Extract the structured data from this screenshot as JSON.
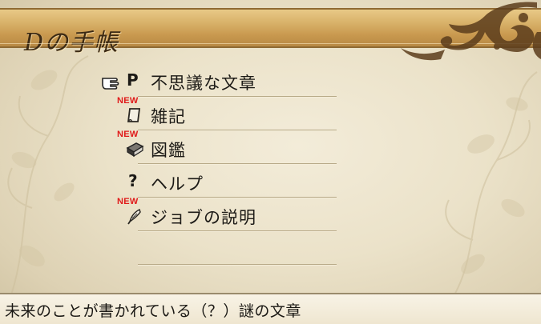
{
  "header": {
    "title": "Dの手帳"
  },
  "menu": {
    "items": [
      {
        "label": "不思議な文章",
        "icon": "pointing-hand-icon",
        "icon_glyph": "P",
        "is_new": false,
        "selected": true
      },
      {
        "label": "雑記",
        "icon": "note-page-icon",
        "is_new": true,
        "new_label": "NEW"
      },
      {
        "label": "図鑑",
        "icon": "book-icon",
        "is_new": true,
        "new_label": "NEW"
      },
      {
        "label": "ヘルプ",
        "icon": "question-icon",
        "icon_glyph": "?",
        "is_new": false
      },
      {
        "label": "ジョブの説明",
        "icon": "quill-icon",
        "is_new": true,
        "new_label": "NEW"
      },
      {
        "label": "",
        "icon": "",
        "is_new": false
      }
    ]
  },
  "description": {
    "text": "未来のことが書かれている（？）謎の文章"
  },
  "colors": {
    "header_gold": "#d9b26a",
    "parchment": "#ebe2c9",
    "new_badge": "#e01a1a",
    "text": "#1c1a16"
  }
}
